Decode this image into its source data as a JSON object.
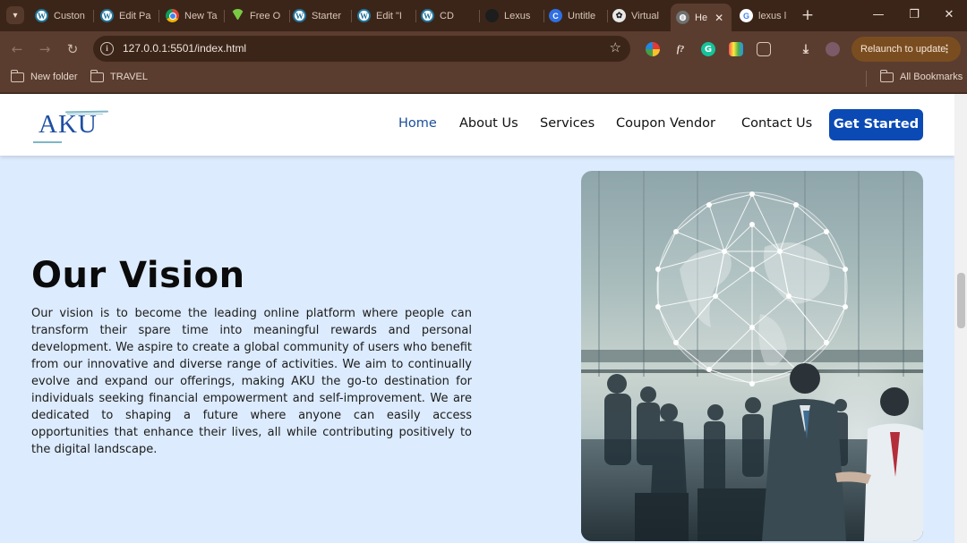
{
  "browser": {
    "tabs": [
      {
        "title": "Custon",
        "favicon": "wordpress-icon"
      },
      {
        "title": "Edit Pa",
        "favicon": "wordpress-icon"
      },
      {
        "title": "New Ta",
        "favicon": "chrome-icon"
      },
      {
        "title": "Free O",
        "favicon": "download-icon"
      },
      {
        "title": "Starter",
        "favicon": "wordpress-icon"
      },
      {
        "title": "Edit \"I",
        "favicon": "wordpress-icon"
      },
      {
        "title": "CD",
        "favicon": "wordpress-icon"
      },
      {
        "title": "Lexus",
        "favicon": "lexus-icon"
      },
      {
        "title": "Untitle",
        "favicon": "canva-icon"
      },
      {
        "title": "Virtual",
        "favicon": "openai-icon"
      },
      {
        "title": "He",
        "favicon": "globe-icon",
        "active": true
      },
      {
        "title": "lexus l",
        "favicon": "google-icon"
      }
    ],
    "tab_close_glyph": "✕",
    "new_tab_glyph": "+",
    "url": "127.0.0.1:5501/index.html",
    "relaunch_label": "Relaunch to update",
    "bookmarks": [
      "New folder",
      "TRAVEL"
    ],
    "all_bookmarks_label": "All Bookmarks"
  },
  "site": {
    "logo_text": "AKU",
    "nav": [
      "Home",
      "About Us",
      "Services",
      "Coupon Vendor",
      "Contact Us"
    ],
    "cta_label": "Get Started",
    "vision": {
      "heading": "Our Vision",
      "body": "Our vision is to become the leading online platform where people can transform their spare time into meaningful rewards and personal development. We aspire to create a global community of users who benefit from our innovative and diverse range of activities. We aim to continually evolve and expand our offerings, making AKU the go-to destination for individuals seeking financial empowerment and self-improvement. We are dedicated to shaping a future where anyone can easily access opportunities that enhance their lives, all while contributing positively to the digital landscape."
    }
  },
  "colors": {
    "browser_frame": "#3b2519",
    "toolbar": "#5a3d2e",
    "page_background": "#dcebfd",
    "nav_active": "#1a4f9c",
    "cta_background": "#0b4ab4",
    "logo": "#1e4fa3"
  }
}
